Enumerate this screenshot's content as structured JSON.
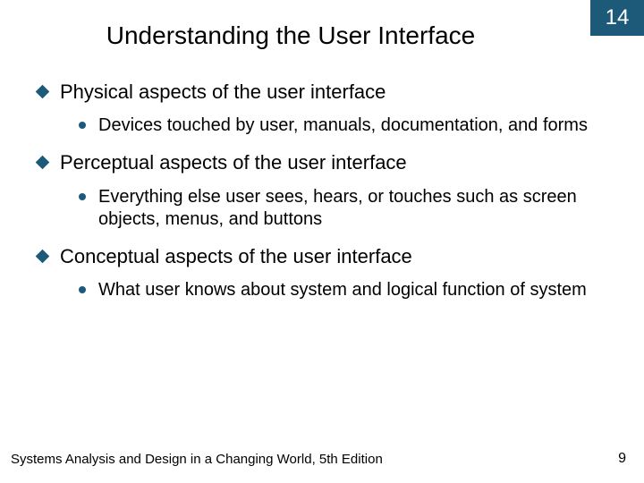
{
  "chapter_number": "14",
  "slide_title": "Understanding the User Interface",
  "topics": [
    {
      "heading": "Physical aspects of the user interface",
      "sub": "Devices touched by user, manuals, documentation, and forms"
    },
    {
      "heading": "Perceptual aspects of the user interface",
      "sub": "Everything else user sees, hears, or touches such as screen objects, menus, and buttons"
    },
    {
      "heading": "Conceptual aspects of the user interface",
      "sub": "What user knows about system and logical function of system"
    }
  ],
  "footer_left": "Systems Analysis and Design in a Changing World, 5th Edition",
  "page_number": "9"
}
